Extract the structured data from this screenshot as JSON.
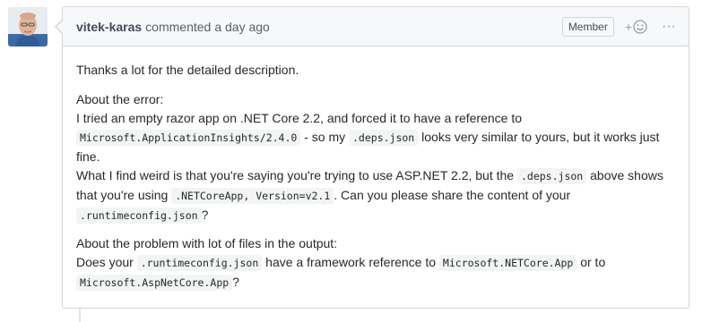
{
  "comment": {
    "author": "vitek-karas",
    "action": "commented",
    "time": "a day ago",
    "badge": "Member",
    "reaction_label": "+",
    "more_label": "···",
    "body": {
      "p1": "Thanks a lot for the detailed description.",
      "p2": {
        "l1": "About the error:",
        "l2": "I tried an empty razor app on .NET Core 2.2, and forced it to have a reference to",
        "c1": "Microsoft.ApplicationInsights/2.4.0",
        "t1": " - so my ",
        "c2": ".deps.json",
        "t2": " looks very similar to yours, but it works just fine.",
        "l3": "What I find weird is that you're saying you're trying to use ASP.NET 2.2, but the ",
        "c3": ".deps.json",
        "t3": " above shows that you're using ",
        "c4": ".NETCoreApp, Version=v2.1",
        "t4": ". Can you please share the content of your ",
        "c5": ".runtimeconfig.json",
        "t5": "?"
      },
      "p3": {
        "l1": "About the problem with lot of files in the output:",
        "t1": "Does your ",
        "c1": ".runtimeconfig.json",
        "t2": " have a framework reference to ",
        "c2": "Microsoft.NETCore.App",
        "t3": " or to ",
        "c3": "Microsoft.AspNetCore.App",
        "t4": "?"
      }
    }
  },
  "colors": {
    "header_bg": "#f6f8fa",
    "border": "#d1d5da",
    "text": "#24292e",
    "muted": "#586069"
  },
  "icons": {
    "avatar": "avatar-image",
    "reaction": "smiley-icon",
    "more": "kebab-horizontal-icon"
  }
}
